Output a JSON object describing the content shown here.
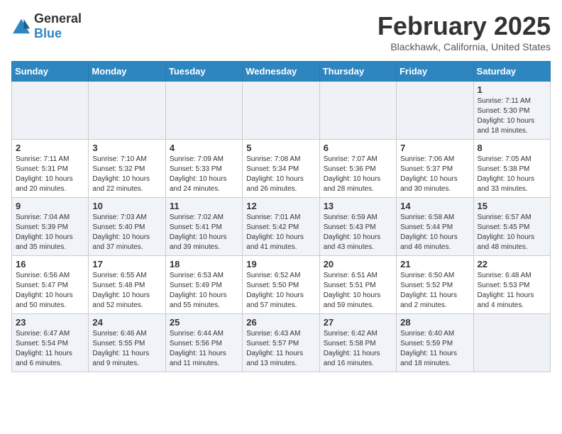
{
  "header": {
    "logo_general": "General",
    "logo_blue": "Blue",
    "month_title": "February 2025",
    "location": "Blackhawk, California, United States"
  },
  "days_of_week": [
    "Sunday",
    "Monday",
    "Tuesday",
    "Wednesday",
    "Thursday",
    "Friday",
    "Saturday"
  ],
  "weeks": [
    [
      {
        "day": "",
        "info": ""
      },
      {
        "day": "",
        "info": ""
      },
      {
        "day": "",
        "info": ""
      },
      {
        "day": "",
        "info": ""
      },
      {
        "day": "",
        "info": ""
      },
      {
        "day": "",
        "info": ""
      },
      {
        "day": "1",
        "info": "Sunrise: 7:11 AM\nSunset: 5:30 PM\nDaylight: 10 hours and 18 minutes."
      }
    ],
    [
      {
        "day": "2",
        "info": "Sunrise: 7:11 AM\nSunset: 5:31 PM\nDaylight: 10 hours and 20 minutes."
      },
      {
        "day": "3",
        "info": "Sunrise: 7:10 AM\nSunset: 5:32 PM\nDaylight: 10 hours and 22 minutes."
      },
      {
        "day": "4",
        "info": "Sunrise: 7:09 AM\nSunset: 5:33 PM\nDaylight: 10 hours and 24 minutes."
      },
      {
        "day": "5",
        "info": "Sunrise: 7:08 AM\nSunset: 5:34 PM\nDaylight: 10 hours and 26 minutes."
      },
      {
        "day": "6",
        "info": "Sunrise: 7:07 AM\nSunset: 5:36 PM\nDaylight: 10 hours and 28 minutes."
      },
      {
        "day": "7",
        "info": "Sunrise: 7:06 AM\nSunset: 5:37 PM\nDaylight: 10 hours and 30 minutes."
      },
      {
        "day": "8",
        "info": "Sunrise: 7:05 AM\nSunset: 5:38 PM\nDaylight: 10 hours and 33 minutes."
      }
    ],
    [
      {
        "day": "9",
        "info": "Sunrise: 7:04 AM\nSunset: 5:39 PM\nDaylight: 10 hours and 35 minutes."
      },
      {
        "day": "10",
        "info": "Sunrise: 7:03 AM\nSunset: 5:40 PM\nDaylight: 10 hours and 37 minutes."
      },
      {
        "day": "11",
        "info": "Sunrise: 7:02 AM\nSunset: 5:41 PM\nDaylight: 10 hours and 39 minutes."
      },
      {
        "day": "12",
        "info": "Sunrise: 7:01 AM\nSunset: 5:42 PM\nDaylight: 10 hours and 41 minutes."
      },
      {
        "day": "13",
        "info": "Sunrise: 6:59 AM\nSunset: 5:43 PM\nDaylight: 10 hours and 43 minutes."
      },
      {
        "day": "14",
        "info": "Sunrise: 6:58 AM\nSunset: 5:44 PM\nDaylight: 10 hours and 46 minutes."
      },
      {
        "day": "15",
        "info": "Sunrise: 6:57 AM\nSunset: 5:45 PM\nDaylight: 10 hours and 48 minutes."
      }
    ],
    [
      {
        "day": "16",
        "info": "Sunrise: 6:56 AM\nSunset: 5:47 PM\nDaylight: 10 hours and 50 minutes."
      },
      {
        "day": "17",
        "info": "Sunrise: 6:55 AM\nSunset: 5:48 PM\nDaylight: 10 hours and 52 minutes."
      },
      {
        "day": "18",
        "info": "Sunrise: 6:53 AM\nSunset: 5:49 PM\nDaylight: 10 hours and 55 minutes."
      },
      {
        "day": "19",
        "info": "Sunrise: 6:52 AM\nSunset: 5:50 PM\nDaylight: 10 hours and 57 minutes."
      },
      {
        "day": "20",
        "info": "Sunrise: 6:51 AM\nSunset: 5:51 PM\nDaylight: 10 hours and 59 minutes."
      },
      {
        "day": "21",
        "info": "Sunrise: 6:50 AM\nSunset: 5:52 PM\nDaylight: 11 hours and 2 minutes."
      },
      {
        "day": "22",
        "info": "Sunrise: 6:48 AM\nSunset: 5:53 PM\nDaylight: 11 hours and 4 minutes."
      }
    ],
    [
      {
        "day": "23",
        "info": "Sunrise: 6:47 AM\nSunset: 5:54 PM\nDaylight: 11 hours and 6 minutes."
      },
      {
        "day": "24",
        "info": "Sunrise: 6:46 AM\nSunset: 5:55 PM\nDaylight: 11 hours and 9 minutes."
      },
      {
        "day": "25",
        "info": "Sunrise: 6:44 AM\nSunset: 5:56 PM\nDaylight: 11 hours and 11 minutes."
      },
      {
        "day": "26",
        "info": "Sunrise: 6:43 AM\nSunset: 5:57 PM\nDaylight: 11 hours and 13 minutes."
      },
      {
        "day": "27",
        "info": "Sunrise: 6:42 AM\nSunset: 5:58 PM\nDaylight: 11 hours and 16 minutes."
      },
      {
        "day": "28",
        "info": "Sunrise: 6:40 AM\nSunset: 5:59 PM\nDaylight: 11 hours and 18 minutes."
      },
      {
        "day": "",
        "info": ""
      }
    ]
  ]
}
